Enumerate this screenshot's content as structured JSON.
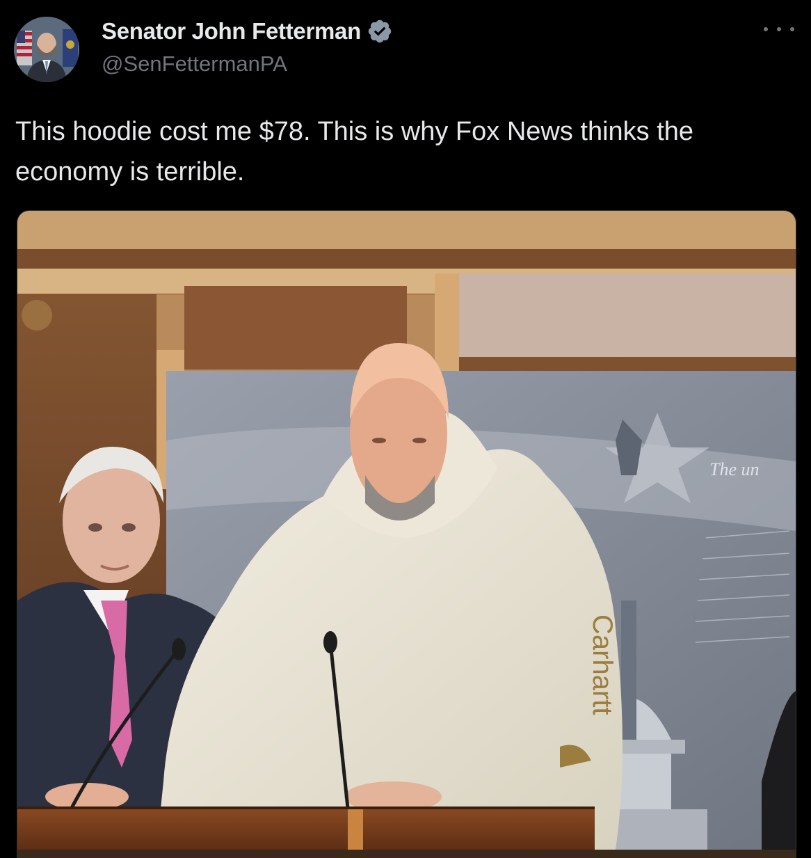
{
  "author": {
    "display_name": "Senator John Fetterman",
    "handle": "@SenFettermanPA",
    "verified": true,
    "verified_badge_color": "#8b98a5"
  },
  "tweet": {
    "text": "This hoodie cost me $78. This is why Fox News thinks the economy is terrible."
  },
  "media": {
    "sleeve_logo_text": "Carhartt",
    "backdrop_script_text": "The un"
  },
  "icons": {
    "more": "more-horizontal-icon",
    "verified": "verified-badge-icon",
    "avatar": "avatar"
  },
  "colors": {
    "background": "#000000",
    "primary_text": "#e7e9ea",
    "secondary_text": "#71767b"
  }
}
